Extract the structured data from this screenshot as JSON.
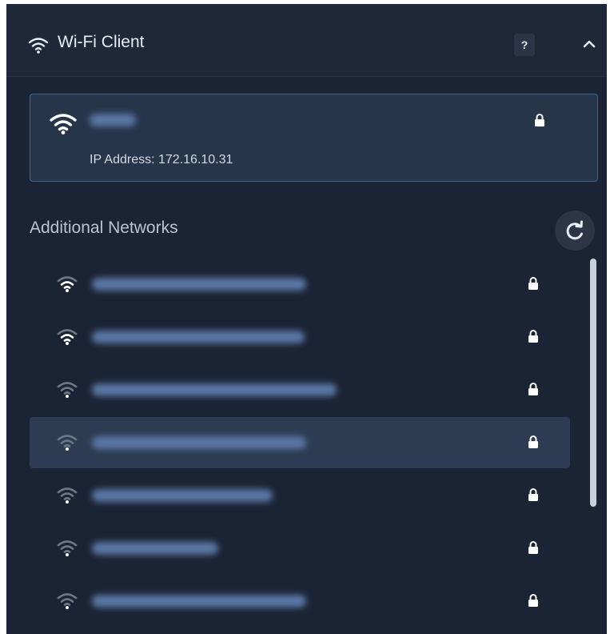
{
  "header": {
    "title": "Wi-Fi Client",
    "help_label": "?",
    "wifi_icon": "wifi-icon",
    "collapse_icon": "chevron-up-icon"
  },
  "connected": {
    "ip_label": "IP Address: 172.16.10.31",
    "lock_icon": "lock-icon"
  },
  "additional": {
    "title": "Additional Networks",
    "refresh_icon": "refresh-icon"
  },
  "networks": [
    {
      "signal": 3,
      "selected": false
    },
    {
      "signal": 3,
      "selected": false
    },
    {
      "signal": 1,
      "selected": false
    },
    {
      "signal": 1,
      "selected": true
    },
    {
      "signal": 1,
      "selected": false
    },
    {
      "signal": 1,
      "selected": false
    },
    {
      "signal": 1,
      "selected": false
    }
  ],
  "colors": {
    "panel_bg": "#1b2434",
    "selected_bg": "#2d3c52",
    "accent_border": "#3f6686",
    "icon_bright": "#ffffff",
    "icon_dim": "#6c7788"
  }
}
